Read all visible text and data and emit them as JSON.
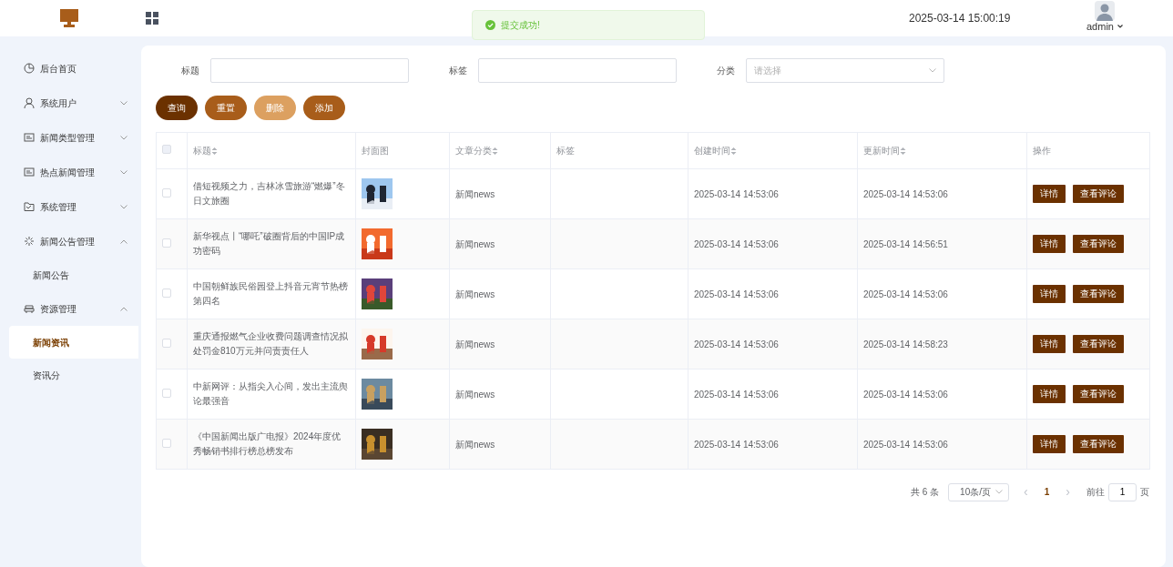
{
  "header": {
    "toast": "提交成功!",
    "datetime": "2025-03-14 15:00:19",
    "user": "admin"
  },
  "sidebar": {
    "items": [
      {
        "label": "后台首页",
        "kind": "link"
      },
      {
        "label": "系统用户",
        "kind": "submenu",
        "expanded": false
      },
      {
        "label": "新闻类型管理",
        "kind": "submenu",
        "expanded": false
      },
      {
        "label": "热点新闻管理",
        "kind": "submenu",
        "expanded": false
      },
      {
        "label": "系统管理",
        "kind": "submenu",
        "expanded": false
      },
      {
        "label": "新闻公告管理",
        "kind": "submenu",
        "expanded": true,
        "children": [
          {
            "label": "新闻公告",
            "selected": false
          }
        ]
      },
      {
        "label": "资源管理",
        "kind": "submenu",
        "expanded": true,
        "children": [
          {
            "label": "新闻资讯",
            "selected": true
          },
          {
            "label": "资讯分",
            "selected": false
          }
        ]
      }
    ]
  },
  "filters": [
    {
      "label": "标题",
      "kind": "text"
    },
    {
      "label": "标签",
      "kind": "text"
    },
    {
      "label": "分类",
      "kind": "select",
      "placeholder": "请选择"
    }
  ],
  "buttons": [
    {
      "label": "查询",
      "kind": "primary",
      "disabled": false
    },
    {
      "label": "重置",
      "kind": "default",
      "disabled": false
    },
    {
      "label": "删除",
      "kind": "default",
      "disabled": true
    },
    {
      "label": "添加",
      "kind": "default",
      "disabled": false
    }
  ],
  "table": {
    "select_all_checked": false,
    "columns": [
      {
        "label": "标题",
        "sortable": true
      },
      {
        "label": "封面图",
        "sortable": false
      },
      {
        "label": "文章分类",
        "sortable": true
      },
      {
        "label": "标签",
        "sortable": false
      },
      {
        "label": "创建时间",
        "sortable": true
      },
      {
        "label": "更新时间",
        "sortable": true
      },
      {
        "label": "操作",
        "sortable": false
      }
    ],
    "rows": [
      {
        "checked": false,
        "title": "借短视频之力，吉林冰雪旅游“燃爆”冬日文旅圈",
        "cover": {
          "kind": "picture"
        },
        "category": "新闻news",
        "created": "2025-03-14 14:53:06",
        "updated": "2025-03-14 14:53:06",
        "actions": [
          "详情",
          "查看评论"
        ]
      },
      {
        "checked": false,
        "title": "新华视点丨“哪吒”破圈背后的中国IP成功密码",
        "cover": {
          "kind": "picture"
        },
        "category": "新闻news",
        "created": "2025-03-14 14:53:06",
        "updated": "2025-03-14 14:56:51",
        "actions": [
          "详情",
          "查看评论"
        ]
      },
      {
        "checked": false,
        "title": "中国朝鲜族民俗园登上抖音元宵节热榜第四名",
        "cover": {
          "kind": "picture"
        },
        "category": "新闻news",
        "created": "2025-03-14 14:53:06",
        "updated": "2025-03-14 14:53:06",
        "actions": [
          "详情",
          "查看评论"
        ]
      },
      {
        "checked": false,
        "title": "重庆通报燃气企业收费问题调查情况拟处罚金810万元并问责责任人",
        "cover": {
          "kind": "picture"
        },
        "category": "新闻news",
        "created": "2025-03-14 14:53:06",
        "updated": "2025-03-14 14:58:23",
        "actions": [
          "详情",
          "查看评论"
        ]
      },
      {
        "checked": false,
        "title": "中新网评：从指尖入心间，发出主流舆论最强音",
        "cover": {
          "kind": "picture"
        },
        "category": "新闻news",
        "created": "2025-03-14 14:53:06",
        "updated": "2025-03-14 14:53:06",
        "actions": [
          "详情",
          "查看评论"
        ]
      },
      {
        "checked": false,
        "title": "《中国新闻出版广电报》2024年度优秀畅销书排行榜总榜发布",
        "cover": {
          "kind": "picture"
        },
        "category": "新闻news",
        "created": "2025-03-14 14:53:06",
        "updated": "2025-03-14 14:53:06",
        "actions": [
          "详情",
          "查看评论"
        ]
      }
    ]
  },
  "pagination": {
    "total": "共 6 条",
    "page_size": "10条/页",
    "prev": "‹",
    "pages": [
      {
        "label": "1",
        "selected": true
      }
    ],
    "next": "›",
    "goto_label": "前往",
    "goto_value": "1",
    "goto_suffix": "页"
  }
}
